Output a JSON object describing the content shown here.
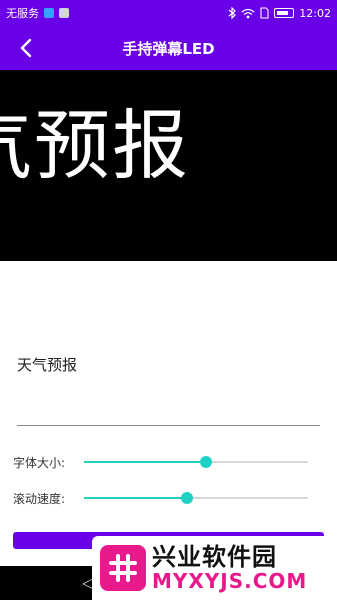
{
  "status_bar": {
    "carrier": "无服务",
    "time": "12:02"
  },
  "app_bar": {
    "title": "手持弹幕LED",
    "back_icon": "chevron-left-icon"
  },
  "led_display": {
    "text": "气预报"
  },
  "message_input": {
    "value": "天气预报"
  },
  "sliders": [
    {
      "label": "字体大小:",
      "value_fraction": 0.545
    },
    {
      "label": "滚动速度:",
      "value_fraction": 0.46
    }
  ],
  "watermark": {
    "name_cn": "兴业软件园",
    "name_en": "MYXYJS.COM"
  },
  "colors": {
    "primary": "#6a00e8",
    "slider": "#1fd1c4",
    "led_background": "#000000",
    "watermark_accent": "#e8198b"
  }
}
